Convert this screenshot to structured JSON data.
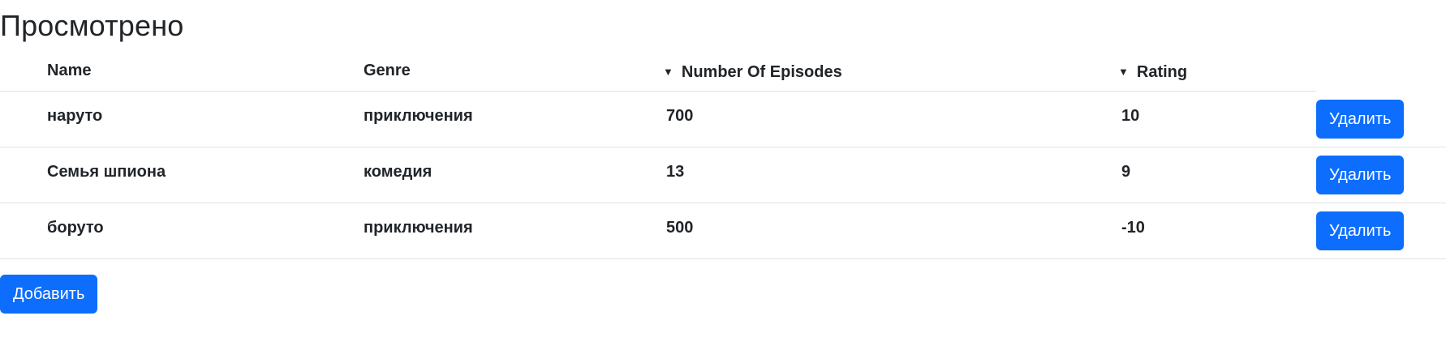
{
  "page": {
    "title": "Просмотрено"
  },
  "table": {
    "columns": {
      "name": "Name",
      "genre": "Genre",
      "episodes": "Number Of Episodes",
      "rating": "Rating"
    },
    "sort_arrow": "▼",
    "rows": [
      {
        "name": "наруто",
        "genre": "приключения",
        "episodes": "700",
        "rating": "10",
        "action_label": "Удалить"
      },
      {
        "name": "Семья шпиона",
        "genre": "комедия",
        "episodes": "13",
        "rating": "9",
        "action_label": "Удалить"
      },
      {
        "name": "боруто",
        "genre": "приключения",
        "episodes": "500",
        "rating": "-10",
        "action_label": "Удалить"
      }
    ]
  },
  "actions": {
    "add_label": "Добавить"
  },
  "colors": {
    "primary": "#0d6efd",
    "text": "#212529",
    "border": "#dee2e6"
  }
}
